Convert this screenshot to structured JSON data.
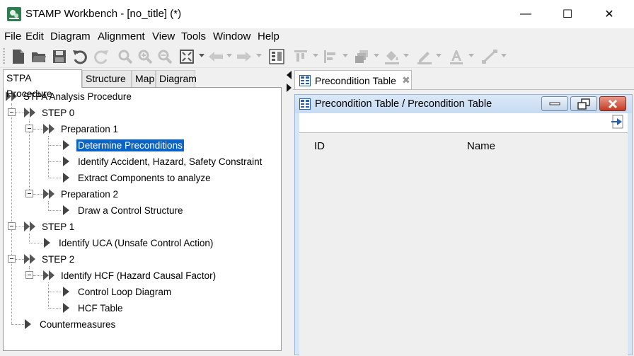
{
  "window": {
    "title": "STAMP Workbench - [no_title] (*)",
    "minimize_glyph": "—",
    "maximize_glyph": "☐",
    "close_glyph": "✕"
  },
  "menu": [
    "File",
    "Edit",
    "Diagram",
    "Alignment",
    "View",
    "Tools",
    "Window",
    "Help"
  ],
  "toolbar_icons": [
    "new-file-icon",
    "open-folder-icon",
    "save-icon",
    "undo-icon",
    "redo-icon",
    "zoom-icon",
    "zoom-in-icon",
    "zoom-out-icon",
    "fit-window-icon",
    "back-icon",
    "forward-icon",
    "grid-icon",
    "align-top-icon",
    "align-left-icon",
    "arrange-icon",
    "fill-color-icon",
    "line-color-icon",
    "font-color-icon",
    "line-style-icon"
  ],
  "left_tabs": [
    "STPA Procedure",
    "Structure",
    "Map",
    "Diagram"
  ],
  "tree": {
    "root": "STPA Analysis Procedure",
    "step0": "STEP 0",
    "prep1": "Preparation 1",
    "determine": "Determine Preconditions",
    "identify_ahs": "Identify Accident, Hazard, Safety Constraint",
    "extract": "Extract Components to analyze",
    "prep2": "Preparation 2",
    "draw": "Draw a Control Structure",
    "step1": "STEP 1",
    "identify_uca": "Identify UCA (Unsafe Control Action)",
    "step2": "STEP 2",
    "identify_hcf": "Identify HCF (Hazard Causal Factor)",
    "control_loop": "Control Loop Diagram",
    "hcf_table": "HCF Table",
    "countermeasures": "Countermeasures"
  },
  "right_tab": {
    "label": "Precondition Table",
    "close_glyph": "✖"
  },
  "inner_window": {
    "title": "Precondition Table / Precondition Table",
    "columns": [
      "ID",
      "Name"
    ]
  },
  "colors": {
    "selection": "#0a64c8",
    "inner_frame": "#d6e6f7",
    "close_button": "#c43b24"
  }
}
